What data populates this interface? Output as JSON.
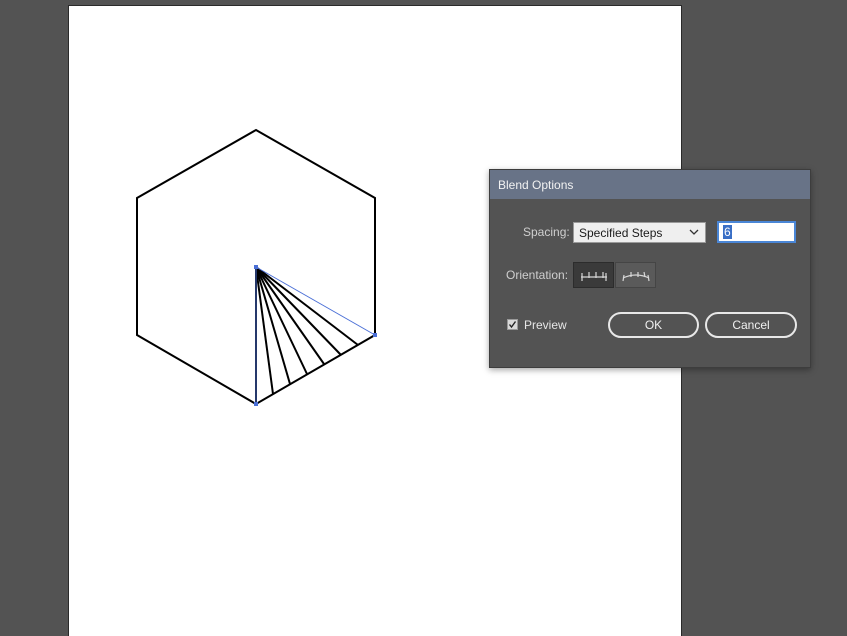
{
  "dialog": {
    "title": "Blend Options",
    "spacing": {
      "label": "Spacing:",
      "selected": "Specified Steps",
      "steps_value": "6"
    },
    "orientation": {
      "label": "Orientation:",
      "options": [
        "align-to-page-icon",
        "align-to-path-icon"
      ],
      "selected": "align-to-page-icon"
    },
    "preview": {
      "label": "Preview",
      "checked": true
    },
    "ok_label": "OK",
    "cancel_label": "Cancel"
  },
  "colors": {
    "workspace": "#535353",
    "titlebar": "#687387",
    "selection": "#4a6fd6"
  }
}
